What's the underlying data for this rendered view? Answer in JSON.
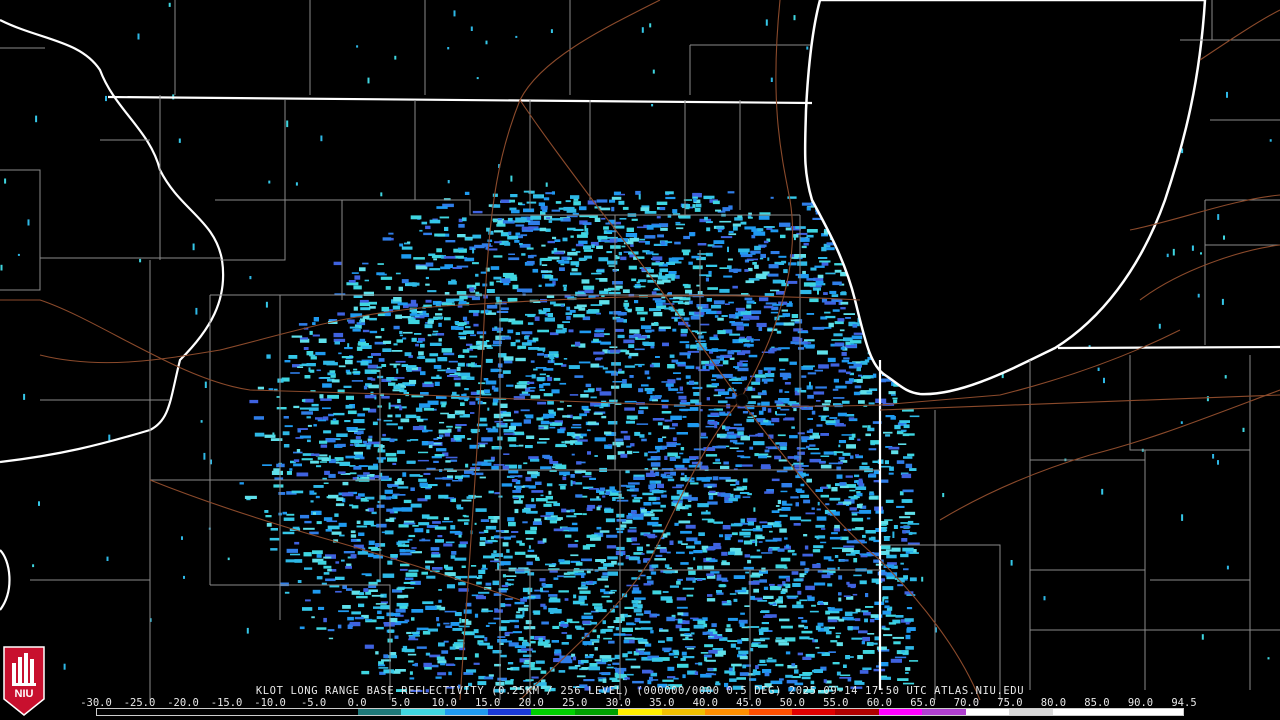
{
  "caption": "KLOT LONG RANGE BASE REFLECTIVITY (0.25KM / 256 LEVEL) (000000/0000 0.5 DEG) 2025-09-14 17:50 UTC  ATLAS.NIU.EDU",
  "logo": {
    "label": "NIU",
    "colors": {
      "red": "#c8102e",
      "white": "#ffffff"
    }
  },
  "scale": {
    "labels": [
      "-30.0",
      "-25.0",
      "-20.0",
      "-15.0",
      "-10.0",
      "-5.0",
      "0.0",
      "5.0",
      "10.0",
      "15.0",
      "20.0",
      "25.0",
      "30.0",
      "35.0",
      "40.0",
      "45.0",
      "50.0",
      "55.0",
      "60.0",
      "65.0",
      "70.0",
      "75.0",
      "80.0",
      "85.0",
      "90.0",
      "94.5"
    ],
    "colors": [
      "#000000",
      "#000000",
      "#000000",
      "#000000",
      "#000000",
      "#000000",
      "#1e7878",
      "#3fd6e0",
      "#1f9af0",
      "#1a3ad8",
      "#00d000",
      "#00a000",
      "#ffee00",
      "#f0c000",
      "#ff9000",
      "#ff5000",
      "#e00000",
      "#b00000",
      "#ff00ff",
      "#b040d0",
      "#ffffff",
      "#d8d8d8",
      "#ffffff",
      "#ffffff",
      "#ffffff"
    ]
  },
  "radar_site": {
    "name": "KLOT"
  }
}
